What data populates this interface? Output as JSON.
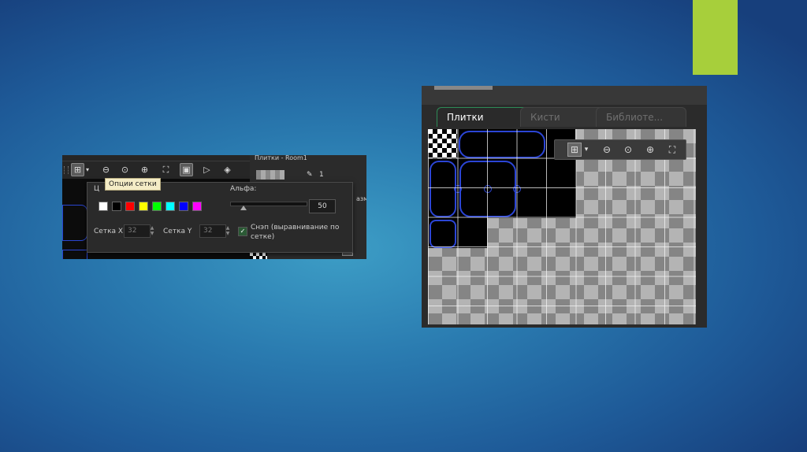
{
  "slide": {
    "accent_color": "#a7cf3b"
  },
  "left_shot": {
    "toolbar_icons": [
      "grid-icon",
      "dropdown-arrow-icon",
      "zoom-out-icon",
      "zoom-reset-icon",
      "zoom-in-icon",
      "fullscreen-icon",
      "frame-icon",
      "play-icon",
      "stamp-icon"
    ],
    "panel_title": "Плитки - Room1",
    "layer_number": "1",
    "partial_label": "азме",
    "tooltip": "Опции сетки",
    "color_label": "Ц",
    "alpha_label": "Альфа:",
    "alpha_value": "50",
    "colors": [
      "#ffffff",
      "#000000",
      "#ff0000",
      "#ffff00",
      "#00ff00",
      "#00ffff",
      "#0000ff",
      "#ff00ff"
    ],
    "grid_x_label": "Сетка X",
    "grid_x_value": "32",
    "grid_y_label": "Сетка Y",
    "grid_y_value": "32",
    "snap_label": "Снэп (выравнивание по сетке)",
    "snap_checked": true
  },
  "right_shot": {
    "tabs": [
      "Плитки",
      "Кисти",
      "Библиоте..."
    ],
    "active_tab": "Плитки",
    "toolbar_icons": [
      "grid-icon",
      "dropdown-arrow-icon",
      "zoom-out-icon",
      "zoom-reset-icon",
      "zoom-in-icon",
      "fullscreen-icon"
    ]
  }
}
